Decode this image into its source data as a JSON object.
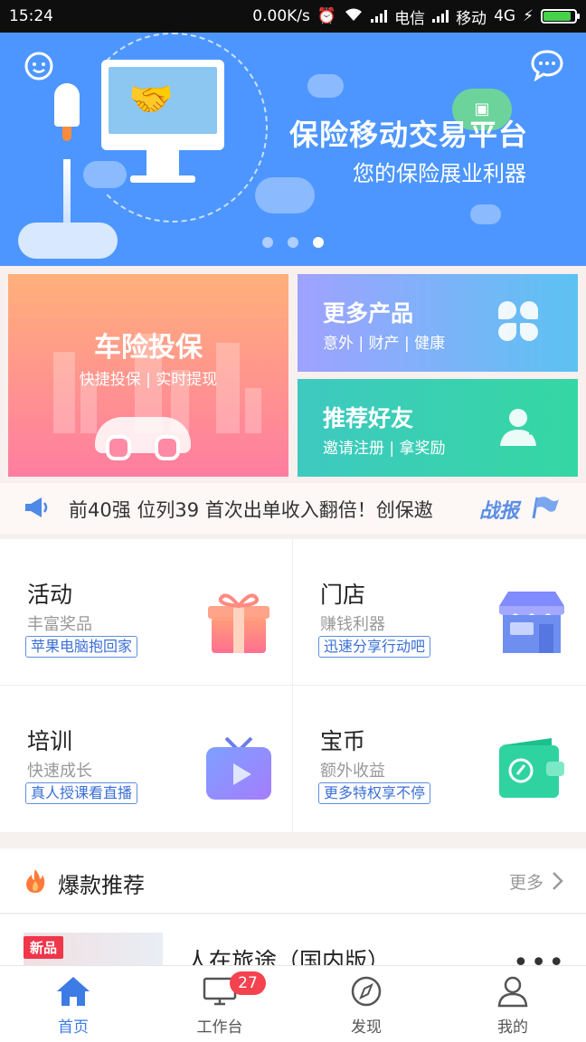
{
  "status_bar": {
    "time": "15:24",
    "speed": "0.00K/s",
    "carrier1": "电信",
    "carrier2": "移动",
    "network": "4G"
  },
  "banner": {
    "title": "保险移动交易平台",
    "subtitle": "您的保险展业利器",
    "slides_total": 3,
    "active_slide": 3
  },
  "cards": {
    "car": {
      "title": "车险投保",
      "subtitle": "快捷投保 | 实时提现"
    },
    "more": {
      "title": "更多产品",
      "subtitle": "意外 | 财产 | 健康"
    },
    "friend": {
      "title": "推荐好友",
      "subtitle": "邀请注册 | 拿奖励"
    }
  },
  "ticker": {
    "text": "前40强 位列39 首次出单收入翻倍！创保遨",
    "label": "战报"
  },
  "features": [
    {
      "title": "活动",
      "subtitle": "丰富奖品",
      "tag": "苹果电脑抱回家",
      "icon": "gift-icon"
    },
    {
      "title": "门店",
      "subtitle": "赚钱利器",
      "tag": "迅速分享行动吧",
      "icon": "store-icon"
    },
    {
      "title": "培训",
      "subtitle": "快速成长",
      "tag": "真人授课看直播",
      "icon": "tv-icon"
    },
    {
      "title": "宝币",
      "subtitle": "额外收益",
      "tag": "更多特权享不停",
      "icon": "wallet-icon"
    }
  ],
  "hot": {
    "title": "爆款推荐",
    "more": "更多"
  },
  "product": {
    "badge": "新品",
    "name": "人在旅途（国内版）",
    "menu": "•••"
  },
  "tabbar": {
    "tabs": [
      {
        "label": "首页",
        "icon": "home-icon",
        "active": true
      },
      {
        "label": "工作台",
        "icon": "workbench-icon",
        "badge": "27"
      },
      {
        "label": "发现",
        "icon": "compass-icon"
      },
      {
        "label": "我的",
        "icon": "user-icon"
      }
    ]
  },
  "colors": {
    "accent": "#3d7be5",
    "banner": "#4d96ff",
    "badge": "#f4424f"
  }
}
